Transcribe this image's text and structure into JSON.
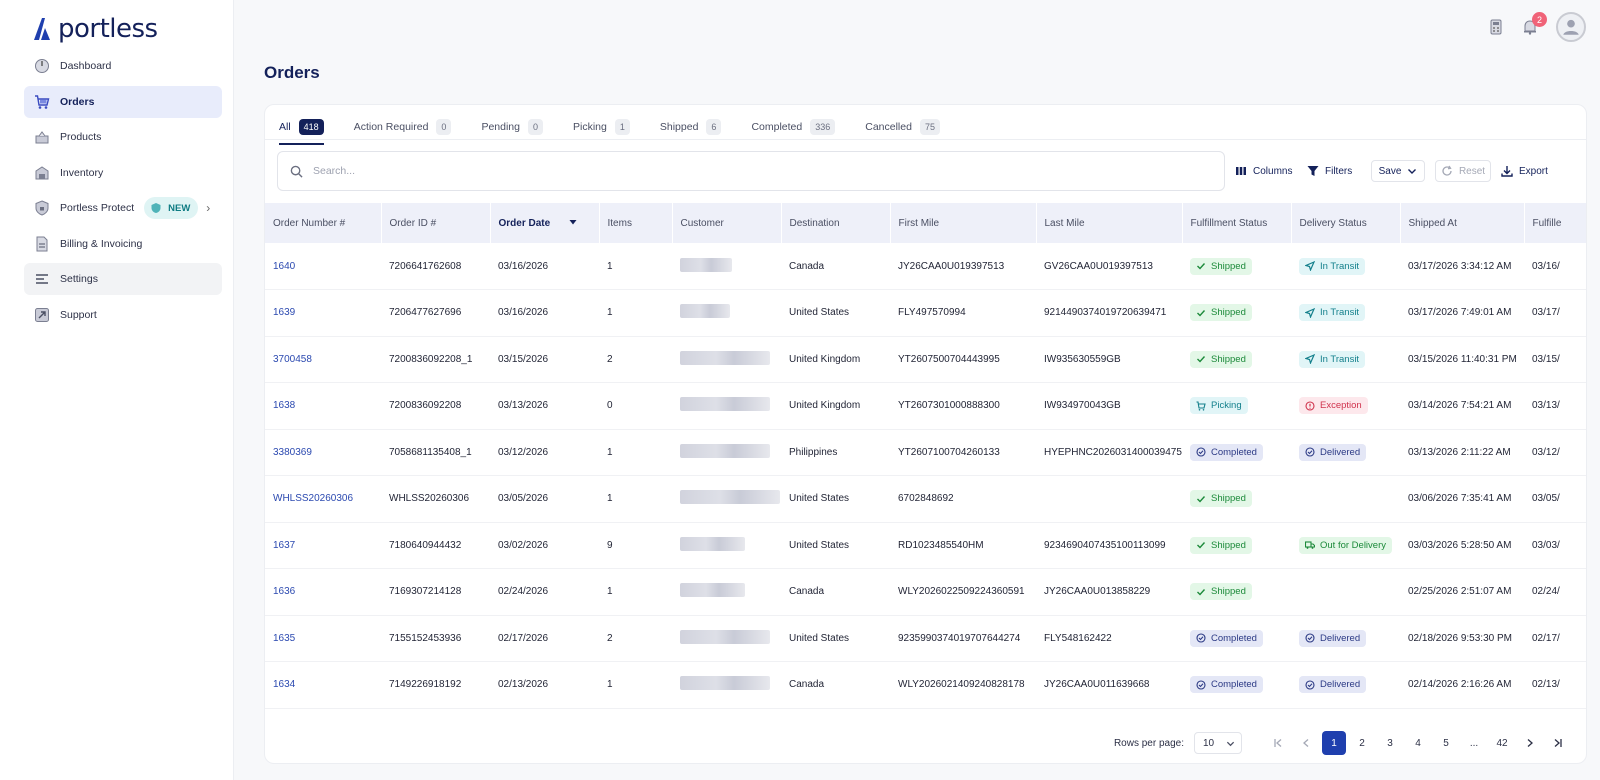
{
  "brand": {
    "name": "portless",
    "color": "#14215a"
  },
  "sidebar": {
    "items": [
      {
        "label": "Dashboard",
        "icon": "dashboard-icon",
        "active": false
      },
      {
        "label": "Orders",
        "icon": "cart-icon",
        "active": true
      },
      {
        "label": "Products",
        "icon": "box-icon",
        "active": false
      },
      {
        "label": "Inventory",
        "icon": "warehouse-icon",
        "active": false
      },
      {
        "label": "Portless Protect",
        "icon": "shield-icon",
        "active": false,
        "badge": "NEW"
      },
      {
        "label": "Billing & Invoicing",
        "icon": "invoice-icon",
        "active": false
      },
      {
        "label": "Settings",
        "icon": "sliders-icon",
        "active": false
      },
      {
        "label": "Support",
        "icon": "support-icon",
        "active": false
      }
    ]
  },
  "topbar": {
    "notification_count": "2"
  },
  "page": {
    "title": "Orders"
  },
  "tabs": [
    {
      "label": "All",
      "count": "418",
      "active": true
    },
    {
      "label": "Action Required",
      "count": "0"
    },
    {
      "label": "Pending",
      "count": "0"
    },
    {
      "label": "Picking",
      "count": "1"
    },
    {
      "label": "Shipped",
      "count": "6"
    },
    {
      "label": "Completed",
      "count": "336"
    },
    {
      "label": "Cancelled",
      "count": "75"
    }
  ],
  "toolbar": {
    "search_placeholder": "Search...",
    "columns_label": "Columns",
    "filters_label": "Filters",
    "save_label": "Save",
    "reset_label": "Reset",
    "export_label": "Export"
  },
  "table": {
    "columns": [
      "Order Number #",
      "Order ID #",
      "Order Date",
      "Items",
      "Customer",
      "Destination",
      "First Mile",
      "Last Mile",
      "Fulfillment Status",
      "Delivery Status",
      "Shipped At",
      "Fulfille"
    ],
    "sorted_column": "Order Date",
    "rows": [
      {
        "order_number": "1640",
        "order_id": "7206641762608",
        "order_date": "03/16/2026",
        "items": "1",
        "destination": "Canada",
        "first_mile": "JY26CAA0U019397513",
        "last_mile": "GV26CAA0U019397513",
        "fulfillment": "Shipped",
        "delivery": "In Transit",
        "shipped_at": "03/17/2026 3:34:12 AM",
        "fulfilled": "03/16/"
      },
      {
        "order_number": "1639",
        "order_id": "7206477627696",
        "order_date": "03/16/2026",
        "items": "1",
        "destination": "United States",
        "first_mile": "FLY497570994",
        "last_mile": "9214490374019720639471",
        "fulfillment": "Shipped",
        "delivery": "In Transit",
        "shipped_at": "03/17/2026 7:49:01 AM",
        "fulfilled": "03/17/"
      },
      {
        "order_number": "3700458",
        "order_id": "7200836092208_1",
        "order_date": "03/15/2026",
        "items": "2",
        "destination": "United Kingdom",
        "first_mile": "YT2607500704443995",
        "last_mile": "IW935630559GB",
        "fulfillment": "Shipped",
        "delivery": "In Transit",
        "shipped_at": "03/15/2026 11:40:31 PM",
        "fulfilled": "03/15/"
      },
      {
        "order_number": "1638",
        "order_id": "7200836092208",
        "order_date": "03/13/2026",
        "items": "0",
        "destination": "United Kingdom",
        "first_mile": "YT2607301000888300",
        "last_mile": "IW934970043GB",
        "fulfillment": "Picking",
        "delivery": "Exception",
        "shipped_at": "03/14/2026 7:54:21 AM",
        "fulfilled": "03/13/"
      },
      {
        "order_number": "3380369",
        "order_id": "7058681135408_1",
        "order_date": "03/12/2026",
        "items": "1",
        "destination": "Philippines",
        "first_mile": "YT2607100704260133",
        "last_mile": "HYEPHNC2026031400039475",
        "fulfillment": "Completed",
        "delivery": "Delivered",
        "shipped_at": "03/13/2026 2:11:22 AM",
        "fulfilled": "03/12/"
      },
      {
        "order_number": "WHLSS20260306",
        "order_id": "WHLSS20260306",
        "order_date": "03/05/2026",
        "items": "1",
        "destination": "United States",
        "first_mile": "6702848692",
        "last_mile": "",
        "fulfillment": "Shipped",
        "delivery": "",
        "shipped_at": "03/06/2026 7:35:41 AM",
        "fulfilled": "03/05/"
      },
      {
        "order_number": "1637",
        "order_id": "7180640944432",
        "order_date": "03/02/2026",
        "items": "9",
        "destination": "United States",
        "first_mile": "RD1023485540HM",
        "last_mile": "9234690407435100113099",
        "fulfillment": "Shipped",
        "delivery": "Out for Delivery",
        "shipped_at": "03/03/2026 5:28:50 AM",
        "fulfilled": "03/03/"
      },
      {
        "order_number": "1636",
        "order_id": "7169307214128",
        "order_date": "02/24/2026",
        "items": "1",
        "destination": "Canada",
        "first_mile": "WLY2026022509224360591",
        "last_mile": "JY26CAA0U013858229",
        "fulfillment": "Shipped",
        "delivery": "",
        "shipped_at": "02/25/2026 2:51:07 AM",
        "fulfilled": "02/24/"
      },
      {
        "order_number": "1635",
        "order_id": "7155152453936",
        "order_date": "02/17/2026",
        "items": "2",
        "destination": "United States",
        "first_mile": "9235990374019707644274",
        "last_mile": "FLY548162422",
        "fulfillment": "Completed",
        "delivery": "Delivered",
        "shipped_at": "02/18/2026 9:53:30 PM",
        "fulfilled": "02/17/"
      },
      {
        "order_number": "1634",
        "order_id": "7149226918192",
        "order_date": "02/13/2026",
        "items": "1",
        "destination": "Canada",
        "first_mile": "WLY2026021409240828178",
        "last_mile": "JY26CAA0U011639668",
        "fulfillment": "Completed",
        "delivery": "Delivered",
        "shipped_at": "02/14/2026 2:16:26 AM",
        "fulfilled": "02/13/"
      }
    ]
  },
  "pagination": {
    "rows_per_page_label": "Rows per page:",
    "rows_per_page_value": "10",
    "pages": [
      "1",
      "2",
      "3",
      "4",
      "5",
      "...",
      "42"
    ],
    "current_page": "1"
  }
}
